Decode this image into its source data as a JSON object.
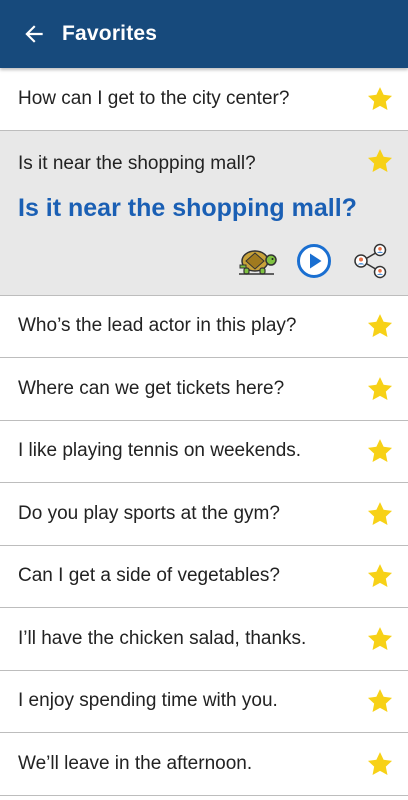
{
  "header": {
    "title": "Favorites",
    "back_icon": "arrow-left-icon"
  },
  "colors": {
    "appbar": "#174a7c",
    "accent_text": "#1a5fb4",
    "star": "#f7d117",
    "expanded_bg": "#e8e8e8"
  },
  "items": [
    {
      "text": "How can I get to the city center?",
      "favorite": true
    },
    {
      "text": "Is it near the shopping mall?",
      "favorite": true,
      "expanded": true,
      "translation": "Is it near the shopping mall?"
    },
    {
      "text": "Who’s the lead actor in this play?",
      "favorite": true
    },
    {
      "text": "Where can we get tickets here?",
      "favorite": true
    },
    {
      "text": "I like playing tennis on weekends.",
      "favorite": true
    },
    {
      "text": "Do you play sports at the gym?",
      "favorite": true
    },
    {
      "text": "Can I get a side of vegetables?",
      "favorite": true
    },
    {
      "text": "I’ll have the chicken salad, thanks.",
      "favorite": true
    },
    {
      "text": "I enjoy spending time with you.",
      "favorite": true
    },
    {
      "text": "We’ll leave in the afternoon.",
      "favorite": true
    }
  ],
  "actions": {
    "slow_icon": "turtle-icon",
    "play_icon": "play-icon",
    "share_icon": "share-icon"
  }
}
